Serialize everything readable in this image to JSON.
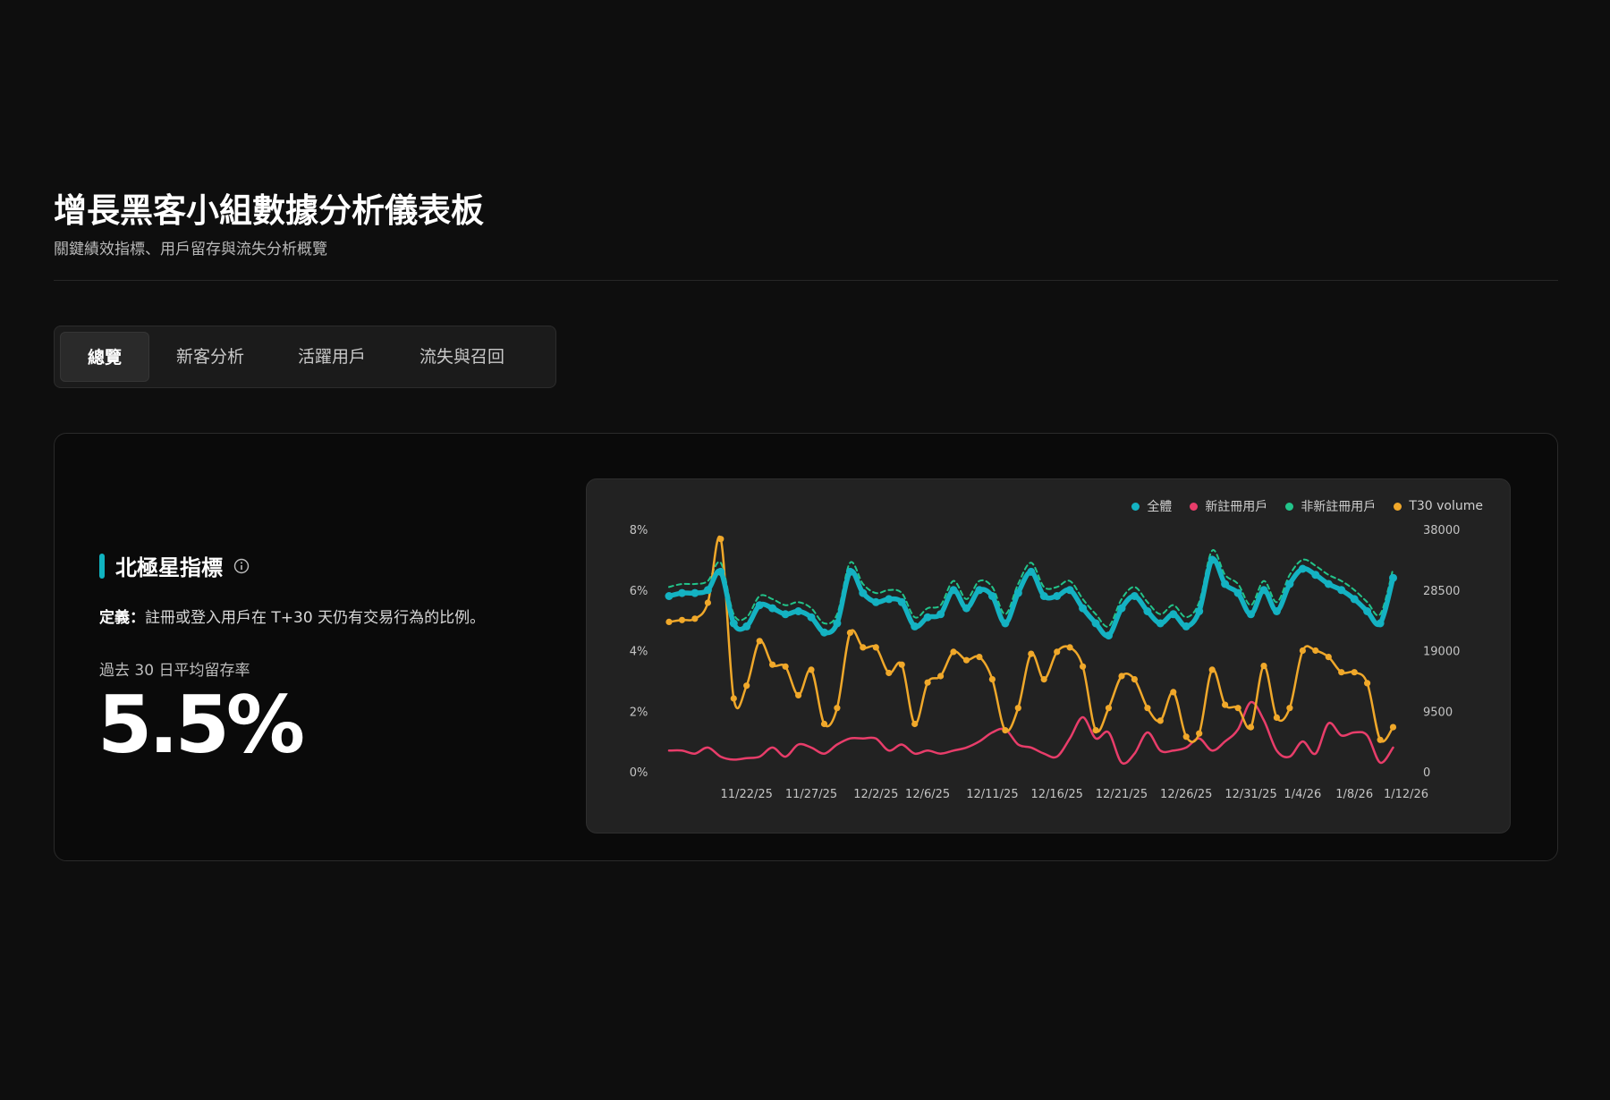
{
  "header": {
    "title": "增長黑客小組數據分析儀表板",
    "subtitle": "關鍵績效指標、用戶留存與流失分析概覽"
  },
  "tabs": [
    {
      "label": "總覽",
      "active": true
    },
    {
      "label": "新客分析",
      "active": false
    },
    {
      "label": "活躍用戶",
      "active": false
    },
    {
      "label": "流失與召回",
      "active": false
    }
  ],
  "metric": {
    "title": "北極星指標",
    "definition_label": "定義：",
    "definition_text": "註冊或登入用戶在 T+30 天仍有交易行為的比例。",
    "avg_label": "過去 30 日平均留存率",
    "value": "5.5%"
  },
  "colors": {
    "all": "#14b2c2",
    "new": "#e83d6a",
    "non_new": "#22c48a",
    "volume": "#f0a82a"
  },
  "chart_data": {
    "type": "line",
    "legend": [
      "全體",
      "新註冊用戶",
      "非新註冊用戶",
      "T30 volume"
    ],
    "legend_position": "top-right",
    "y_left_ticks": [
      "0%",
      "2%",
      "4%",
      "6%",
      "8%"
    ],
    "y_left_range": [
      0,
      8
    ],
    "y_right_ticks": [
      "0",
      "9500",
      "19000",
      "28500",
      "38000"
    ],
    "y_right_range": [
      0,
      38000
    ],
    "x_tick_labels": [
      "11/22/25",
      "11/27/25",
      "12/2/25",
      "12/6/25",
      "12/11/25",
      "12/16/25",
      "12/21/25",
      "12/26/25",
      "12/31/25",
      "1/4/26",
      "1/8/26",
      "1/12/26"
    ],
    "x_tick_days": [
      6,
      11,
      16,
      20,
      25,
      30,
      35,
      40,
      45,
      49,
      53,
      57
    ],
    "x_range_days": [
      0,
      57
    ],
    "grid": false,
    "series": [
      {
        "name": "全體",
        "axis": "left",
        "values": [
          5.8,
          5.9,
          5.9,
          6.0,
          6.6,
          4.9,
          4.8,
          5.5,
          5.4,
          5.2,
          5.3,
          5.1,
          4.6,
          4.9,
          6.6,
          5.9,
          5.6,
          5.7,
          5.6,
          4.8,
          5.1,
          5.2,
          6.0,
          5.4,
          6.0,
          5.8,
          4.9,
          5.9,
          6.6,
          5.8,
          5.8,
          6.0,
          5.4,
          4.9,
          4.5,
          5.4,
          5.8,
          5.3,
          4.9,
          5.2,
          4.8,
          5.3,
          7.0,
          6.2,
          5.9,
          5.2,
          6.0,
          5.3,
          6.2,
          6.7,
          6.5,
          6.2,
          6.0,
          5.7,
          5.3,
          4.9,
          6.4
        ]
      },
      {
        "name": "新註冊用戶",
        "axis": "left",
        "values": [
          0.7,
          0.7,
          0.6,
          0.8,
          0.5,
          0.4,
          0.45,
          0.5,
          0.8,
          0.5,
          0.9,
          0.8,
          0.6,
          0.9,
          1.1,
          1.1,
          1.1,
          0.7,
          0.9,
          0.6,
          0.7,
          0.6,
          0.7,
          0.8,
          1.0,
          1.3,
          1.4,
          0.9,
          0.8,
          0.6,
          0.5,
          1.1,
          1.8,
          1.1,
          1.3,
          0.3,
          0.6,
          1.3,
          0.7,
          0.7,
          0.8,
          1.1,
          0.7,
          1.0,
          1.4,
          2.3,
          1.7,
          0.7,
          0.5,
          1.0,
          0.6,
          1.6,
          1.2,
          1.3,
          1.2,
          0.3,
          0.8
        ]
      },
      {
        "name": "非新註冊用戶",
        "axis": "left",
        "values": [
          6.1,
          6.2,
          6.2,
          6.3,
          6.9,
          5.2,
          5.1,
          5.8,
          5.7,
          5.5,
          5.6,
          5.4,
          4.9,
          5.2,
          6.9,
          6.2,
          5.9,
          6.0,
          5.9,
          5.1,
          5.4,
          5.5,
          6.3,
          5.7,
          6.3,
          6.1,
          5.2,
          6.2,
          6.9,
          6.1,
          6.1,
          6.3,
          5.7,
          5.2,
          4.8,
          5.7,
          6.1,
          5.6,
          5.2,
          5.5,
          5.1,
          5.6,
          7.3,
          6.5,
          6.2,
          5.5,
          6.3,
          5.6,
          6.5,
          7.0,
          6.8,
          6.5,
          6.3,
          6.0,
          5.6,
          5.2,
          6.7
        ]
      },
      {
        "name": "T30 volume",
        "axis": "right",
        "values": [
          23500,
          23800,
          24000,
          26500,
          36500,
          11500,
          13500,
          20500,
          16800,
          16500,
          12000,
          16000,
          7500,
          10000,
          21800,
          19500,
          19500,
          15500,
          16800,
          7500,
          14000,
          15000,
          18800,
          17500,
          18000,
          14500,
          6500,
          10000,
          18500,
          14500,
          18800,
          19500,
          16500,
          6500,
          10000,
          15000,
          14500,
          10000,
          8000,
          12500,
          5500,
          6000,
          16000,
          10500,
          10000,
          7000,
          16600,
          8500,
          10000,
          19000,
          19000,
          18000,
          15600,
          15600,
          13900,
          5000,
          7000
        ]
      }
    ]
  }
}
